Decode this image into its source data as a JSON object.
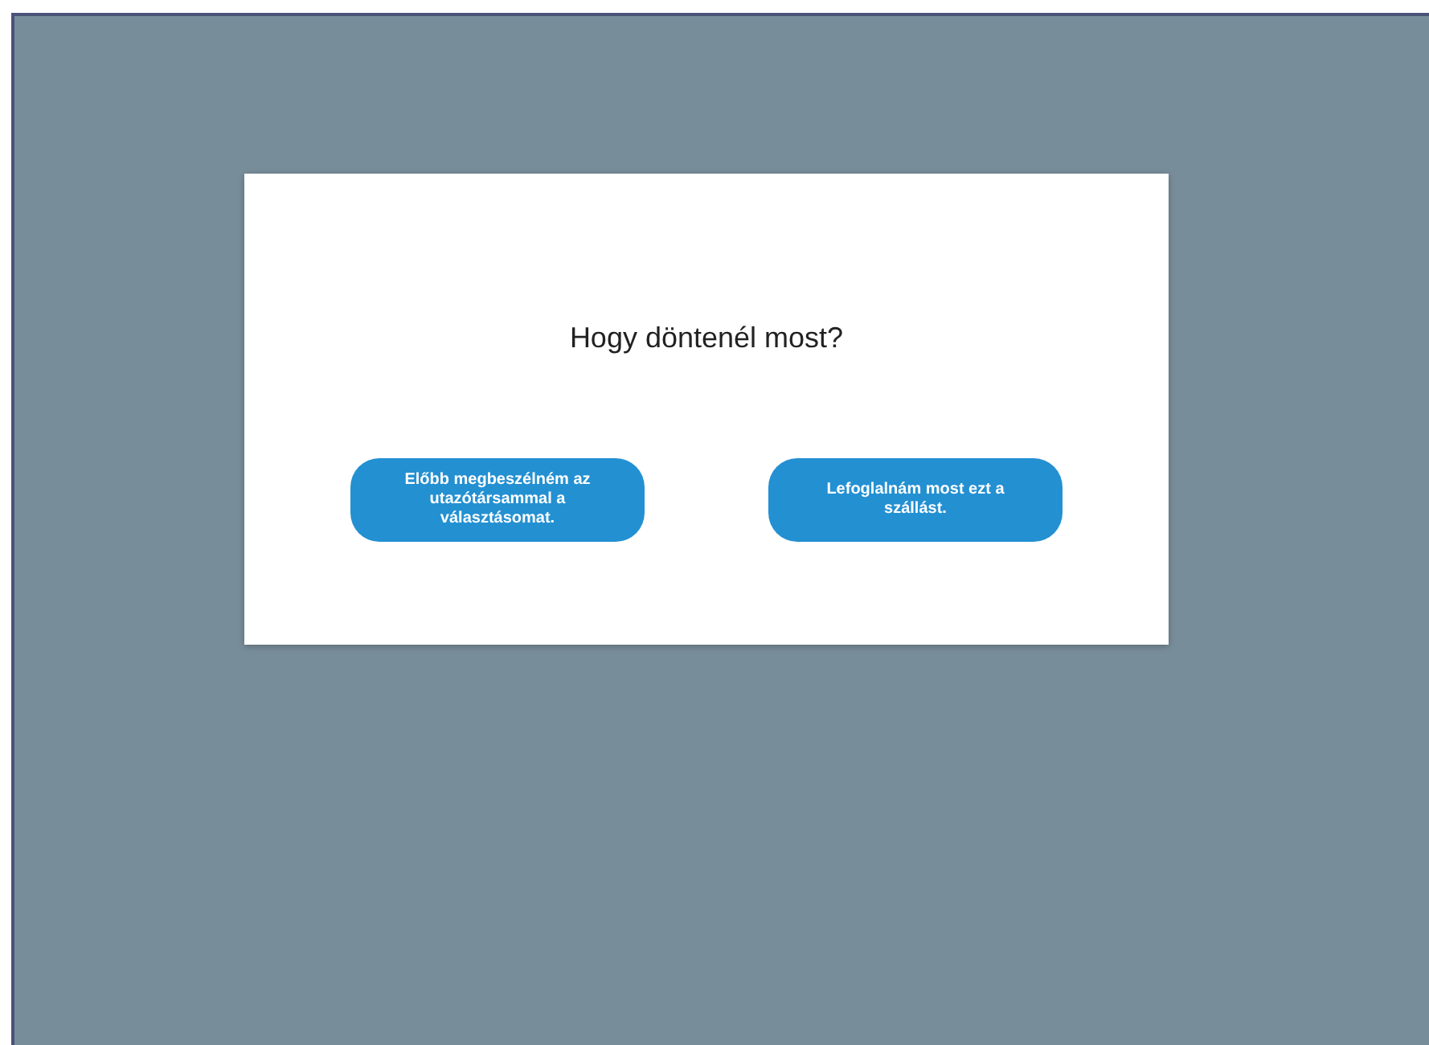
{
  "dialog": {
    "question": "Hogy döntenél most?",
    "buttons": [
      {
        "label": "Előbb megbeszélném az utazótársammal a választásomat."
      },
      {
        "label": "Lefoglalnám most ezt a szállást."
      }
    ]
  }
}
